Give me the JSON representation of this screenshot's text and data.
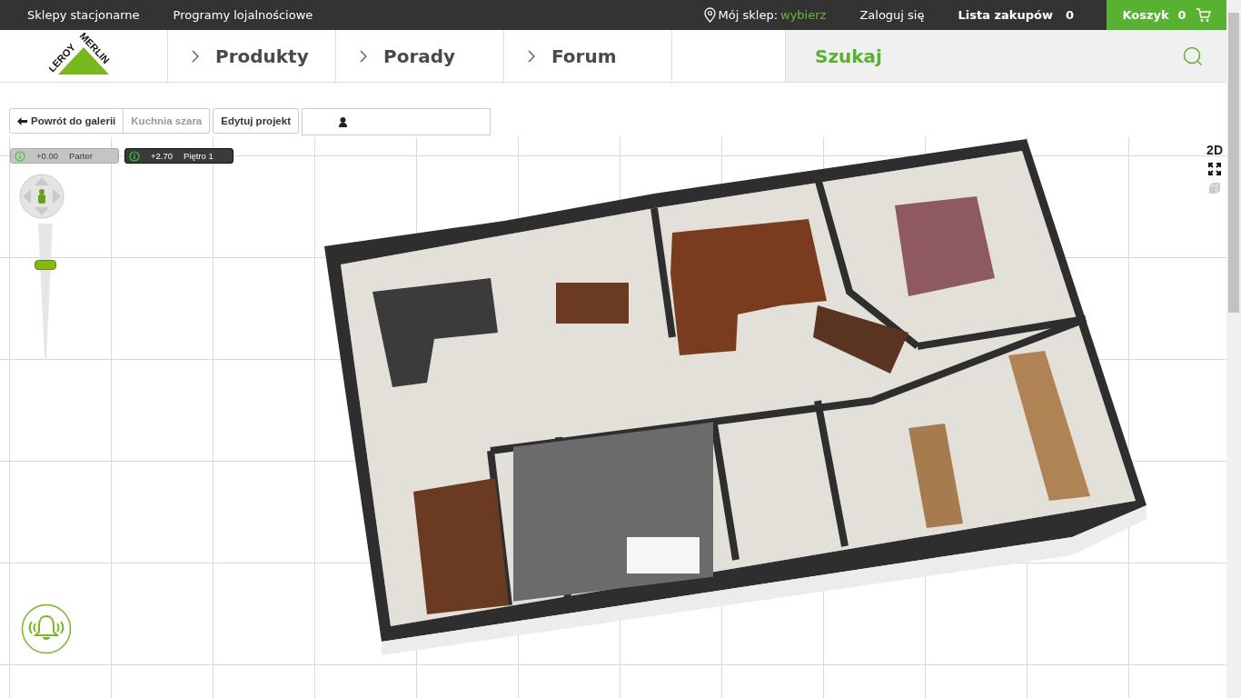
{
  "top_bar": {
    "links": [
      "Sklepy stacjonarne",
      "Programy lojalnościowe"
    ],
    "store": {
      "label": "Mój sklep:",
      "value": "wybierz"
    },
    "login": "Zaloguj się",
    "shopping_list": {
      "label": "Lista zakupów",
      "count": "0"
    },
    "cart": {
      "label": "Koszyk",
      "count": "0"
    }
  },
  "logo": {
    "left": "LEROY",
    "right": "MERLIN"
  },
  "nav": {
    "items": [
      "Produkty",
      "Porady",
      "Forum"
    ],
    "search": {
      "placeholder": "Szukaj"
    }
  },
  "toolbar": {
    "back": "Powrót do galerii",
    "project_name": "Kuchnia szara",
    "edit": "Edytuj projekt"
  },
  "floors": [
    {
      "height": "+0.00",
      "name": "Parter",
      "selected": false
    },
    {
      "height": "+2.70",
      "name": "Piętro 1",
      "selected": true
    }
  ],
  "view_controls": {
    "mode": "2D"
  },
  "zoom": {
    "level": 0.71
  }
}
